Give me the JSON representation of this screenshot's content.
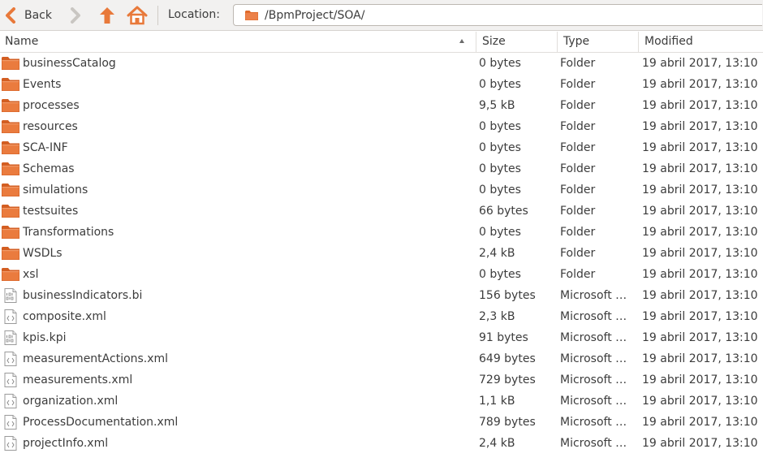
{
  "toolbar": {
    "back_label": "Back",
    "location_label": "Location:",
    "location_path": "/BpmProject/SOA/"
  },
  "columns": {
    "name": "Name",
    "size": "Size",
    "type": "Type",
    "modified": "Modified"
  },
  "colors": {
    "folder": "#e06a2b",
    "arrow": "#e8793a"
  },
  "files": [
    {
      "name": "businessCatalog",
      "size": "0 bytes",
      "type": "Folder",
      "modified": "19 abril 2017, 13:10",
      "icon": "folder-icon"
    },
    {
      "name": "Events",
      "size": "0 bytes",
      "type": "Folder",
      "modified": "19 abril 2017, 13:10",
      "icon": "folder-icon"
    },
    {
      "name": "processes",
      "size": "9,5 kB",
      "type": "Folder",
      "modified": "19 abril 2017, 13:10",
      "icon": "folder-icon"
    },
    {
      "name": "resources",
      "size": "0 bytes",
      "type": "Folder",
      "modified": "19 abril 2017, 13:10",
      "icon": "folder-icon"
    },
    {
      "name": "SCA-INF",
      "size": "0 bytes",
      "type": "Folder",
      "modified": "19 abril 2017, 13:10",
      "icon": "folder-icon"
    },
    {
      "name": "Schemas",
      "size": "0 bytes",
      "type": "Folder",
      "modified": "19 abril 2017, 13:10",
      "icon": "folder-icon"
    },
    {
      "name": "simulations",
      "size": "0 bytes",
      "type": "Folder",
      "modified": "19 abril 2017, 13:10",
      "icon": "folder-icon"
    },
    {
      "name": "testsuites",
      "size": "66 bytes",
      "type": "Folder",
      "modified": "19 abril 2017, 13:10",
      "icon": "folder-icon"
    },
    {
      "name": "Transformations",
      "size": "0 bytes",
      "type": "Folder",
      "modified": "19 abril 2017, 13:10",
      "icon": "folder-icon"
    },
    {
      "name": "WSDLs",
      "size": "2,4 kB",
      "type": "Folder",
      "modified": "19 abril 2017, 13:10",
      "icon": "folder-icon"
    },
    {
      "name": "xsl",
      "size": "0 bytes",
      "type": "Folder",
      "modified": "19 abril 2017, 13:10",
      "icon": "folder-icon"
    },
    {
      "name": "businessIndicators.bi",
      "size": "156 bytes",
      "type": "Microsoft …",
      "modified": "19 abril 2017, 13:10",
      "icon": "binary-file-icon"
    },
    {
      "name": "composite.xml",
      "size": "2,3 kB",
      "type": "Microsoft …",
      "modified": "19 abril 2017, 13:10",
      "icon": "xml-file-icon"
    },
    {
      "name": "kpis.kpi",
      "size": "91 bytes",
      "type": "Microsoft …",
      "modified": "19 abril 2017, 13:10",
      "icon": "binary-file-icon"
    },
    {
      "name": "measurementActions.xml",
      "size": "649 bytes",
      "type": "Microsoft …",
      "modified": "19 abril 2017, 13:10",
      "icon": "xml-file-icon"
    },
    {
      "name": "measurements.xml",
      "size": "729 bytes",
      "type": "Microsoft …",
      "modified": "19 abril 2017, 13:10",
      "icon": "xml-file-icon"
    },
    {
      "name": "organization.xml",
      "size": "1,1 kB",
      "type": "Microsoft …",
      "modified": "19 abril 2017, 13:10",
      "icon": "xml-file-icon"
    },
    {
      "name": "ProcessDocumentation.xml",
      "size": "789 bytes",
      "type": "Microsoft …",
      "modified": "19 abril 2017, 13:10",
      "icon": "xml-file-icon"
    },
    {
      "name": "projectInfo.xml",
      "size": "2,4 kB",
      "type": "Microsoft …",
      "modified": "19 abril 2017, 13:10",
      "icon": "xml-file-icon"
    }
  ]
}
